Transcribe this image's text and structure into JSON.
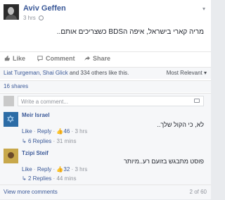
{
  "post": {
    "author": "Aviv Geffen",
    "time": "3 hrs",
    "text": "מריה קארי בישראל, איפה הBDS כשצריכים אותם.."
  },
  "actions": {
    "like": "Like",
    "comment": "Comment",
    "share": "Share"
  },
  "reactions": {
    "names": "Liat Turgeman, Shai Glick",
    "rest": " and 334 others like this.",
    "sort": "Most Relevant"
  },
  "shares": "16 shares",
  "composer": {
    "placeholder": "Write a comment..."
  },
  "comments": [
    {
      "author": "Meir Israel",
      "text": "לא, כי הקול שלך..",
      "like": "Like",
      "reply": "Reply",
      "likes": "46",
      "time": "3 hrs",
      "replies": "6 Replies",
      "replies_time": "31 mins"
    },
    {
      "author": "Tzipi Steif",
      "text": "פוסט מתבגש בזועם רע..מיותר",
      "like": "Like",
      "reply": "Reply",
      "likes": "32",
      "time": "3 hrs",
      "replies": "2 Replies",
      "replies_time": "44 mins"
    }
  ],
  "footer": {
    "view_more": "View more comments",
    "count": "2 of 60"
  },
  "colors": {
    "link": "#3b5998",
    "muted": "#90949c",
    "background": "#f6f7f9"
  }
}
